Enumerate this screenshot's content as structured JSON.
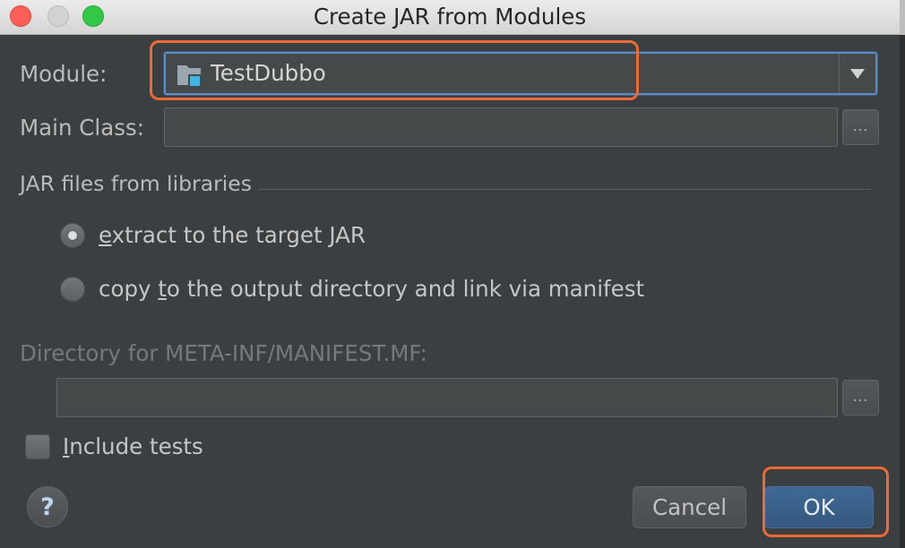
{
  "window": {
    "title": "Create JAR from Modules"
  },
  "module": {
    "label": "Module:",
    "value": "TestDubbo",
    "icon": "module-folder-icon",
    "dropdown_icon": "dropdown-arrow-icon"
  },
  "main_class": {
    "label": "Main Class:",
    "value": "",
    "browse_label": "..."
  },
  "libraries": {
    "title": "JAR files from libraries",
    "options": [
      {
        "label": "extract to the target JAR",
        "mnemonic": "e",
        "selected": true
      },
      {
        "label": "copy to the output directory and link via manifest",
        "mnemonic": "t",
        "selected": false
      }
    ]
  },
  "manifest_dir": {
    "label": "Directory for META-INF/MANIFEST.MF:",
    "value": "",
    "browse_label": "...",
    "enabled": false
  },
  "include_tests": {
    "label": "Include tests",
    "mnemonic": "I",
    "checked": false
  },
  "footer": {
    "help_label": "?",
    "cancel_label": "Cancel",
    "ok_label": "OK"
  },
  "theme": {
    "background": "#3c3f41",
    "text": "#bbbbbb",
    "value_text": "#d6d6d6",
    "disabled_text": "#76787a",
    "field_bg": "#45494a",
    "focus_ring": "#5b8cc4",
    "default_button": "#365880",
    "highlight": "#ee6a34",
    "close": "#fc5f57",
    "minimize": "#d2d2d2",
    "zoom": "#33c748"
  }
}
